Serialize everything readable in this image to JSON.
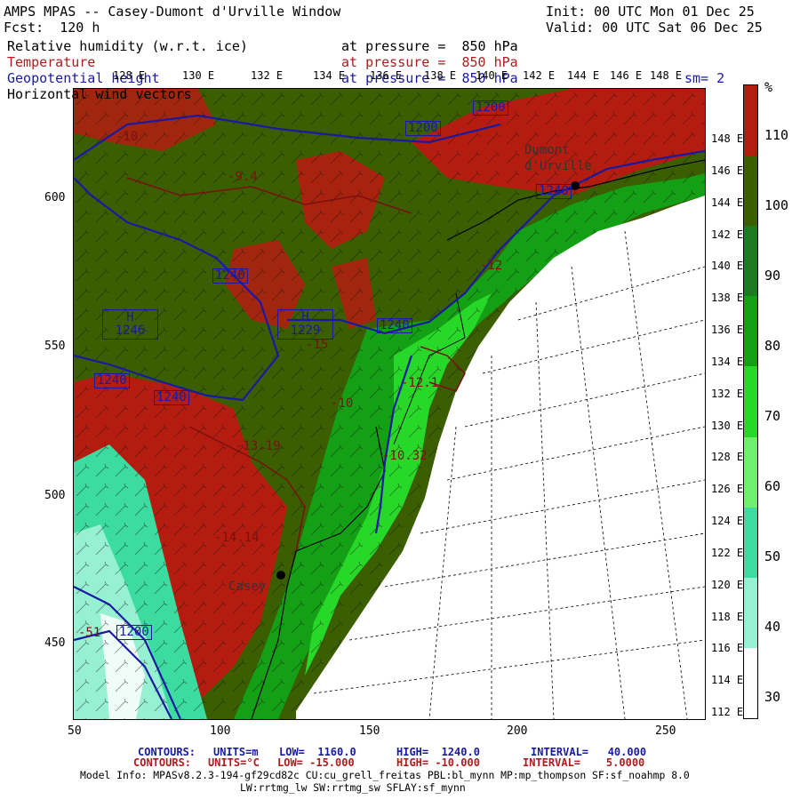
{
  "header": {
    "title": "AMPS MPAS -- Casey-Dumont d'Urville Window",
    "forecast": "Fcst:  120 h",
    "init": "Init: 00 UTC Mon 01 Dec 25",
    "valid": "Valid: 00 UTC Sat 06 Dec 25"
  },
  "fields": [
    {
      "name": "Relative humidity (w.r.t. ice)",
      "level": "at pressure =  850 hPa",
      "color": "#000000"
    },
    {
      "name": "Temperature",
      "level": "at pressure =  850 hPa",
      "color": "#aa1e1e"
    },
    {
      "name": "Geopotential height",
      "level": "at pressure =  850 hPa",
      "color": "#1a1aa0"
    },
    {
      "name": "Horizontal wind vectors",
      "level": "at pressure =  850 hPa",
      "color": "#000000"
    }
  ],
  "smoothing": "sm= 2",
  "map": {
    "x_ticks": [
      "50",
      "100",
      "150",
      "200",
      "250"
    ],
    "y_ticks": [
      "600",
      "550",
      "500",
      "450"
    ],
    "lon_labels_top": [
      "128 E",
      "130 E",
      "132 E",
      "134 E",
      "136 E",
      "138 E",
      "140 E",
      "142 E",
      "144 E",
      "146 E",
      "148 E"
    ],
    "lat_labels_right": [
      "148 E",
      "146 E",
      "144 E",
      "142 E",
      "140 E",
      "138 E",
      "136 E",
      "134 E",
      "132 E",
      "130 E",
      "128 E",
      "126 E",
      "124 E",
      "122 E",
      "120 E",
      "118 E",
      "116 E",
      "114 E",
      "112 E"
    ],
    "height_labels": [
      "1200",
      "1200",
      "1240",
      "1240",
      "1240",
      "1240",
      "1240",
      "1200"
    ],
    "highs": [
      {
        "label": "H",
        "value": "1246"
      },
      {
        "label": "H",
        "value": "1229"
      }
    ],
    "temp_labels": [
      "-10",
      "-9.4",
      "-15",
      "-12.1",
      "-13.19",
      "-10",
      "-10.32",
      "-14.14",
      "-12",
      "-51"
    ],
    "places": [
      "Dumont d'Urville",
      "Casey"
    ]
  },
  "colorbar": {
    "unit": "%",
    "labels": [
      "110",
      "100",
      "90",
      "80",
      "70",
      "60",
      "50",
      "40",
      "30"
    ],
    "colors": [
      "#b51c10",
      "#3a5e00",
      "#1e7a1e",
      "#14a014",
      "#28d828",
      "#6ef06e",
      "#3cdca0",
      "#96f0d2",
      "#ffffff"
    ]
  },
  "footer": {
    "contours1": {
      "label": "CONTOURS:",
      "units": "UNITS=m",
      "low": "LOW=  1160.0",
      "high": "HIGH=  1240.0",
      "interval": "INTERVAL=   40.000"
    },
    "contours2": {
      "label": "CONTOURS:",
      "units": "UNITS=°C",
      "low": "LOW= -15.000",
      "high": "HIGH= -10.000",
      "interval": "INTERVAL=    5.0000"
    },
    "model_info": "Model Info: MPASv8.2.3-194-gf29cd82c CU:cu_grell_freitas PBL:bl_mynn MP:mp_thompson SF:sf_noahmp 8.0",
    "model_info2": "LW:rrtmg_lw SW:rrtmg_sw SFLAY:sf_mynn"
  }
}
